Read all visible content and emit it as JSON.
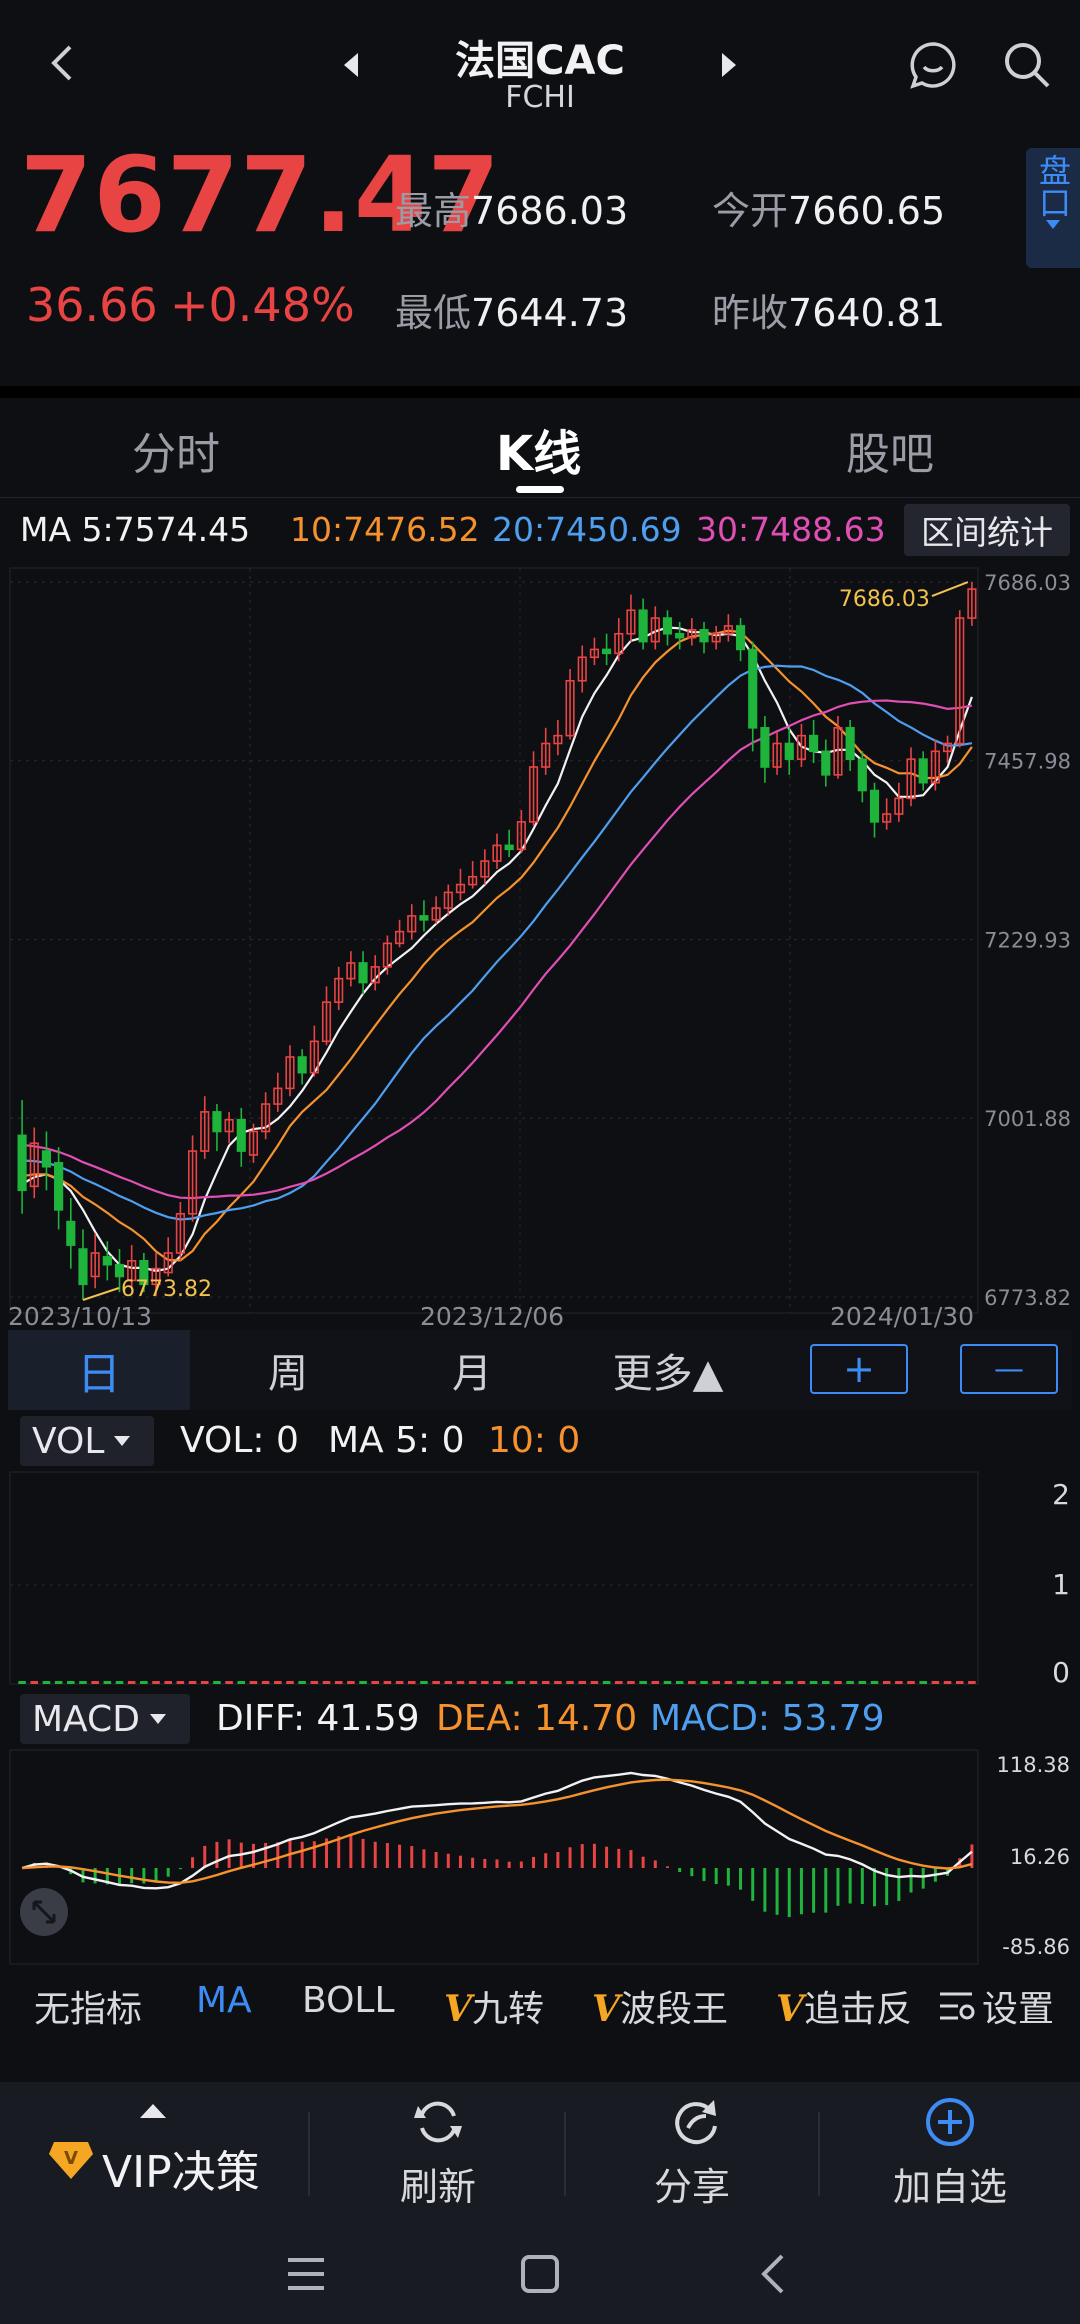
{
  "header": {
    "title": "法国CAC",
    "subtitle": "FCHI"
  },
  "quote": {
    "price": "7677.47",
    "change": "36.66",
    "change_pct": "+0.48%",
    "high_label": "最高",
    "high": "7686.03",
    "open_label": "今开",
    "open": "7660.65",
    "low_label": "最低",
    "low": "7644.73",
    "prev_label": "昨收",
    "prev": "7640.81",
    "side_tab": "盘口"
  },
  "tabs": [
    {
      "label": "分时"
    },
    {
      "label": "K线"
    },
    {
      "label": "股吧"
    }
  ],
  "ma_row": {
    "ma5": "MA 5:7574.45",
    "ma10": "10:7476.52",
    "ma20": "20:7450.69",
    "ma30": "30:7488.63",
    "interval_btn": "区间统计"
  },
  "colors": {
    "up": "#e84444",
    "down": "#1fb43c",
    "ma5": "#f2f2f2",
    "ma10": "#f5922e",
    "ma20": "#4f9ff0",
    "ma30": "#e04fb4",
    "accent": "#3d8bf5"
  },
  "chart_data": [
    {
      "type": "candlestick",
      "y_ticks": [
        "7686.03",
        "7457.98",
        "7229.93",
        "7001.88",
        "6773.82"
      ],
      "ylim": [
        6773.82,
        7686.03
      ],
      "x_ticks": [
        "2023/10/13",
        "2023/12/06",
        "2024/01/30"
      ],
      "max_label": "7686.03",
      "min_label": "6773.82",
      "candles": [
        [
          6980,
          6910,
          7025,
          6880
        ],
        [
          6915,
          6970,
          6990,
          6900
        ],
        [
          6960,
          6940,
          6985,
          6910
        ],
        [
          6945,
          6885,
          6965,
          6860
        ],
        [
          6870,
          6840,
          6900,
          6810
        ],
        [
          6835,
          6790,
          6860,
          6770
        ],
        [
          6800,
          6830,
          6855,
          6785
        ],
        [
          6825,
          6815,
          6845,
          6795
        ],
        [
          6815,
          6800,
          6835,
          6780
        ],
        [
          6795,
          6820,
          6840,
          6785
        ],
        [
          6820,
          6790,
          6830,
          6780
        ],
        [
          6790,
          6810,
          6830,
          6775
        ],
        [
          6805,
          6830,
          6850,
          6800
        ],
        [
          6830,
          6880,
          6895,
          6820
        ],
        [
          6880,
          6960,
          6980,
          6870
        ],
        [
          6960,
          7010,
          7030,
          6950
        ],
        [
          7010,
          6985,
          7020,
          6960
        ],
        [
          6985,
          7000,
          7010,
          6970
        ],
        [
          7000,
          6960,
          7015,
          6940
        ],
        [
          6955,
          6985,
          6995,
          6945
        ],
        [
          6985,
          7020,
          7035,
          6975
        ],
        [
          7020,
          7040,
          7060,
          7010
        ],
        [
          7040,
          7080,
          7095,
          7030
        ],
        [
          7080,
          7060,
          7090,
          7045
        ],
        [
          7060,
          7100,
          7120,
          7055
        ],
        [
          7100,
          7150,
          7170,
          7095
        ],
        [
          7150,
          7180,
          7195,
          7140
        ],
        [
          7180,
          7200,
          7215,
          7170
        ],
        [
          7200,
          7175,
          7215,
          7160
        ],
        [
          7175,
          7195,
          7210,
          7165
        ],
        [
          7195,
          7225,
          7235,
          7185
        ],
        [
          7225,
          7240,
          7255,
          7220
        ],
        [
          7240,
          7260,
          7275,
          7230
        ],
        [
          7260,
          7255,
          7280,
          7240
        ],
        [
          7255,
          7270,
          7285,
          7250
        ],
        [
          7270,
          7290,
          7300,
          7260
        ],
        [
          7290,
          7300,
          7320,
          7280
        ],
        [
          7300,
          7310,
          7330,
          7295
        ],
        [
          7310,
          7330,
          7345,
          7300
        ],
        [
          7330,
          7350,
          7365,
          7320
        ],
        [
          7350,
          7345,
          7370,
          7335
        ],
        [
          7345,
          7380,
          7395,
          7340
        ],
        [
          7380,
          7450,
          7470,
          7375
        ],
        [
          7450,
          7480,
          7500,
          7440
        ],
        [
          7480,
          7490,
          7510,
          7465
        ],
        [
          7490,
          7560,
          7575,
          7485
        ],
        [
          7560,
          7590,
          7605,
          7545
        ],
        [
          7590,
          7600,
          7615,
          7580
        ],
        [
          7600,
          7595,
          7620,
          7580
        ],
        [
          7595,
          7620,
          7640,
          7585
        ],
        [
          7620,
          7650,
          7670,
          7610
        ],
        [
          7650,
          7610,
          7665,
          7600
        ],
        [
          7610,
          7640,
          7655,
          7600
        ],
        [
          7640,
          7620,
          7650,
          7605
        ],
        [
          7620,
          7615,
          7635,
          7600
        ],
        [
          7615,
          7625,
          7640,
          7605
        ],
        [
          7625,
          7610,
          7635,
          7595
        ],
        [
          7610,
          7620,
          7630,
          7600
        ],
        [
          7620,
          7630,
          7645,
          7610
        ],
        [
          7630,
          7600,
          7640,
          7585
        ],
        [
          7600,
          7500,
          7610,
          7470
        ],
        [
          7500,
          7450,
          7515,
          7430
        ],
        [
          7450,
          7480,
          7495,
          7440
        ],
        [
          7480,
          7460,
          7500,
          7440
        ],
        [
          7460,
          7490,
          7505,
          7450
        ],
        [
          7490,
          7470,
          7510,
          7455
        ],
        [
          7470,
          7440,
          7485,
          7425
        ],
        [
          7440,
          7500,
          7515,
          7435
        ],
        [
          7500,
          7460,
          7510,
          7445
        ],
        [
          7460,
          7420,
          7470,
          7405
        ],
        [
          7420,
          7380,
          7430,
          7360
        ],
        [
          7380,
          7390,
          7410,
          7370
        ],
        [
          7390,
          7410,
          7430,
          7380
        ],
        [
          7410,
          7460,
          7475,
          7400
        ],
        [
          7460,
          7430,
          7470,
          7420
        ],
        [
          7430,
          7470,
          7485,
          7420
        ],
        [
          7470,
          7480,
          7490,
          7455
        ],
        [
          7480,
          7640,
          7650,
          7475
        ],
        [
          7640,
          7677,
          7686,
          7630
        ]
      ]
    },
    {
      "type": "bar",
      "title": "VOL",
      "y_ticks": [
        "2",
        "1",
        "0"
      ],
      "ylim": [
        0,
        2
      ],
      "values_note": "VOL: 0"
    },
    {
      "type": "bar+line",
      "title": "MACD",
      "y_ticks": [
        "118.38",
        "16.26",
        "-85.86"
      ],
      "ylim": [
        -85.86,
        118.38
      ]
    }
  ],
  "period_bar": {
    "day": "日",
    "week": "周",
    "month": "月",
    "more": "更多▲",
    "zoom_in": "+",
    "zoom_out": "—"
  },
  "vol_row": {
    "selector": "VOL",
    "vol": "VOL: 0",
    "ma5": "MA 5: 0",
    "ma10": "10: 0"
  },
  "macd_row": {
    "selector": "MACD",
    "diff": "DIFF: 41.59",
    "dea": "DEA: 14.70",
    "macd": "MACD: 53.79"
  },
  "indicators": {
    "none": "无指标",
    "ma": "MA",
    "boll": "BOLL",
    "v1": "九转",
    "v2": "波段王",
    "v3": "追击反",
    "settings": "设置",
    "v_mark": "V"
  },
  "bottom_nav": {
    "vip": "VIP决策",
    "refresh": "刷新",
    "share": "分享",
    "add": "加自选"
  }
}
